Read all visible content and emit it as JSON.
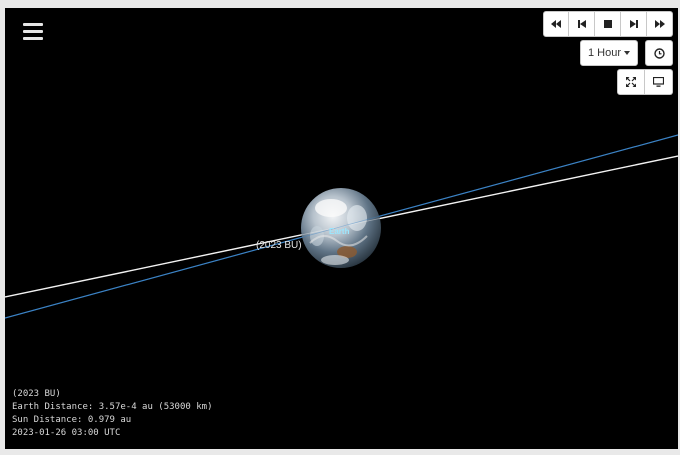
{
  "toolbar": {
    "rewind_icon": "fast-backward-icon",
    "step_back_icon": "step-backward-icon",
    "stop_icon": "stop-icon",
    "step_forward_icon": "step-forward-icon",
    "fast_forward_icon": "fast-forward-icon",
    "time_step_label": "1 Hour"
  },
  "scene": {
    "asteroid_label": "(2023 BU)",
    "earth_label": "Earth",
    "orbit_colors": {
      "asteroid": "#f2f2f2",
      "earth": "#3b82c4"
    }
  },
  "info": {
    "object": "(2023 BU)",
    "earth_distance": "Earth Distance: 3.57e-4 au (53000 km)",
    "sun_distance": "Sun Distance: 0.979 au",
    "datetime": "2023-01-26 03:00 UTC"
  }
}
